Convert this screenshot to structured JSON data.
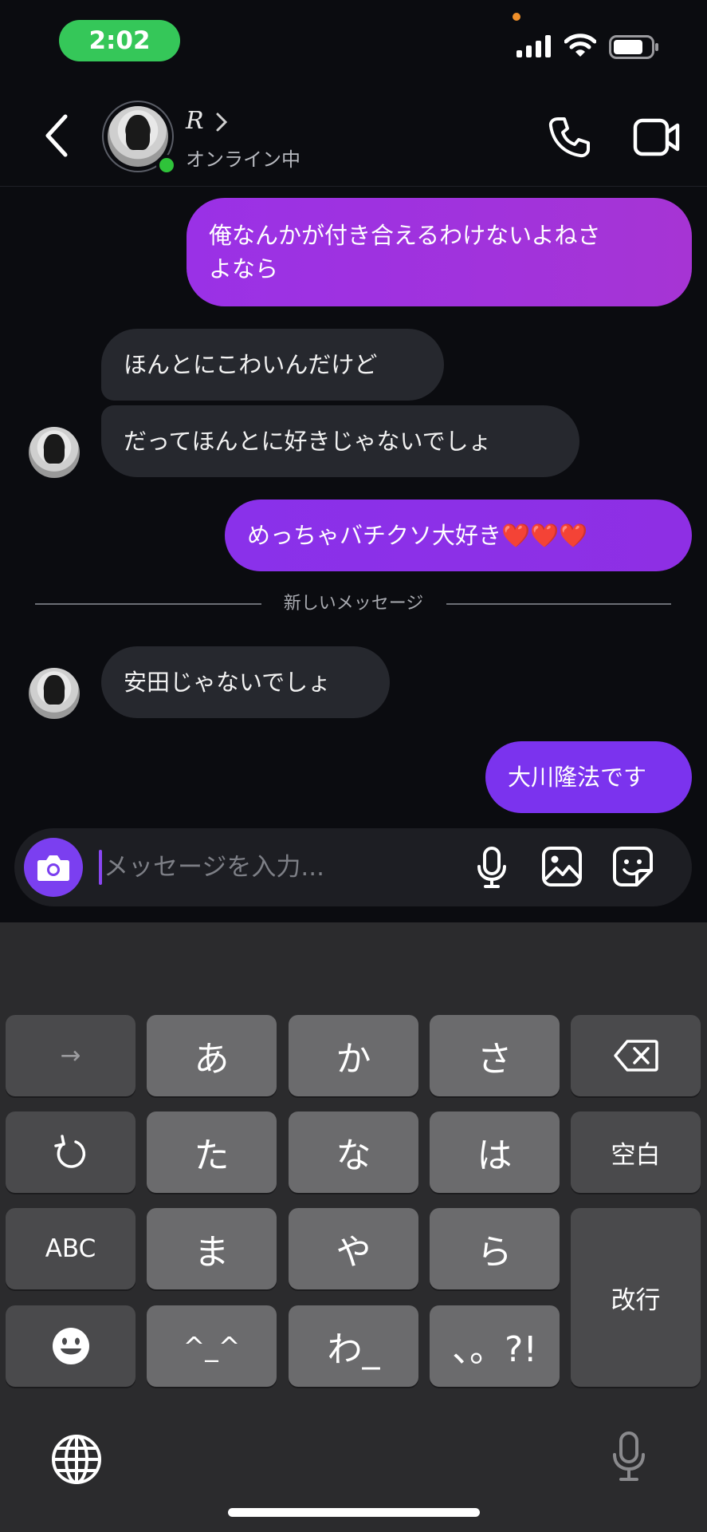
{
  "status_bar": {
    "time": "2:02",
    "accent_color": "#35c759"
  },
  "header": {
    "contact_name": "R",
    "presence": "オンライン中",
    "icons": [
      "back-icon",
      "chevron-right-icon",
      "phone-icon",
      "video-camera-icon"
    ]
  },
  "messages": [
    {
      "direction": "sent",
      "lines": [
        "俺なんかが付き合えるわけないよねさ",
        "よなら"
      ]
    },
    {
      "direction": "received",
      "text": "ほんとにこわいんだけど"
    },
    {
      "direction": "received",
      "text": "だってほんとに好きじゃないでしょ"
    },
    {
      "direction": "sent",
      "text": "めっちゃバチクソ大好き❤️❤️❤️"
    },
    {
      "direction": "received",
      "text": "安田じゃないでしょ"
    },
    {
      "direction": "sent",
      "text": "大川隆法です"
    }
  ],
  "divider": {
    "label": "新しいメッセージ"
  },
  "composer": {
    "placeholder": "メッセージを入力...",
    "value": "",
    "icons": [
      "camera-icon",
      "microphone-icon",
      "image-icon",
      "sticker-icon"
    ]
  },
  "keyboard": {
    "rows": [
      [
        "→",
        "あ",
        "か",
        "さ",
        "⌫"
      ],
      [
        "↺",
        "た",
        "な",
        "は",
        "空白"
      ],
      [
        "ABC",
        "ま",
        "や",
        "ら",
        "改行"
      ],
      [
        "☻",
        "^_^",
        "わ_",
        "、。?!"
      ]
    ],
    "labels": {
      "arrow": "→",
      "a": "あ",
      "ka": "か",
      "sa": "さ",
      "ta": "た",
      "na": "な",
      "ha": "は",
      "space": "空白",
      "abc": "ABC",
      "ma": "ま",
      "ya": "や",
      "ra": "ら",
      "return": "改行",
      "kaomoji": "^_^",
      "wa": "わ_",
      "punct": "、。?!"
    }
  },
  "colors": {
    "background": "#0b0c10",
    "sent_bubble": "#8d2fe6",
    "received_bubble": "#26282e",
    "online": "#2fc33a",
    "keyboard_bg": "#2b2b2d"
  }
}
